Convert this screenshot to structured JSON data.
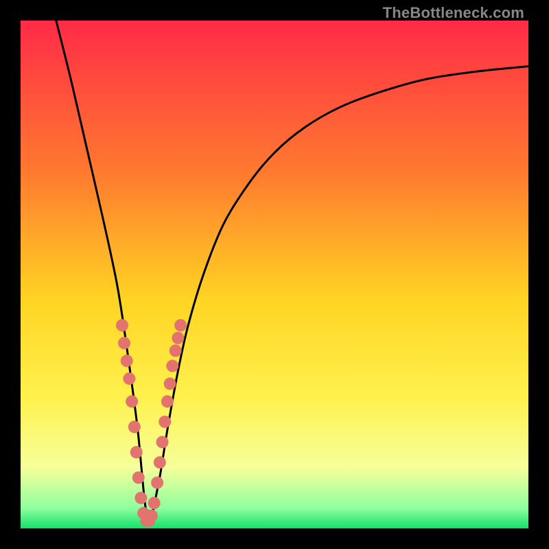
{
  "watermark": {
    "text": "TheBottleneck.com"
  },
  "colors": {
    "background": "#000000",
    "curve": "#000000",
    "marker_fill": "#e2736f",
    "grad_top": "#ff2b47",
    "grad_mid1": "#ff7a2f",
    "grad_mid2": "#ffd423",
    "grad_mid3": "#fff14d",
    "grad_low1": "#f6ff9a",
    "grad_low2": "#8fff9e",
    "grad_bottom": "#15e06c"
  },
  "chart_data": {
    "type": "line",
    "title": "",
    "xlabel": "",
    "ylabel": "",
    "xlim": [
      0,
      100
    ],
    "ylim": [
      0,
      100
    ],
    "note": "Axes are unlabeled in the image; x and y are normalized 0–100 estimates read from pixel positions. The curve is a V-shaped bottleneck profile with its minimum near x≈25, y≈0.",
    "series": [
      {
        "name": "bottleneck-curve",
        "x": [
          7,
          10,
          13,
          16,
          19,
          21,
          23,
          25,
          27,
          29,
          31,
          33,
          36,
          40,
          45,
          50,
          56,
          63,
          71,
          80,
          90,
          100
        ],
        "y": [
          100,
          88,
          75,
          62,
          48,
          35,
          20,
          2,
          8,
          20,
          31,
          40,
          50,
          60,
          68,
          74,
          79,
          83,
          86,
          88.5,
          90,
          91
        ]
      },
      {
        "name": "marker-cluster",
        "type_override": "scatter",
        "x": [
          20.0,
          20.4,
          20.9,
          21.4,
          21.9,
          22.4,
          22.8,
          23.2,
          23.7,
          24.2,
          24.8,
          25.3,
          25.8,
          26.3,
          26.9,
          27.4,
          27.9,
          28.4,
          28.9,
          29.4,
          29.9,
          30.5,
          31.0,
          31.5
        ],
        "y": [
          40.0,
          36.5,
          33.0,
          29.5,
          25.0,
          20.0,
          15.0,
          10.0,
          6.0,
          3.0,
          1.5,
          1.5,
          2.5,
          5.0,
          9.0,
          13.0,
          17.0,
          21.0,
          25.0,
          28.5,
          32.0,
          35.0,
          37.5,
          40.0
        ]
      }
    ]
  }
}
